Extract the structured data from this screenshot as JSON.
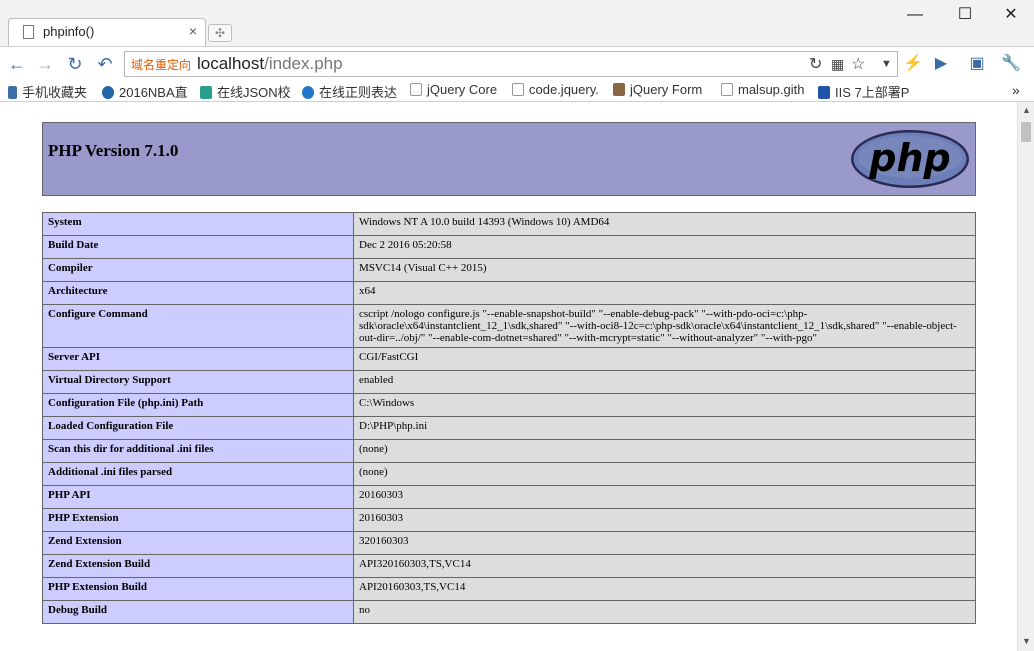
{
  "browser": {
    "tab_title": "phpinfo()",
    "tab_close": "×",
    "window_controls": {
      "minimize": "—",
      "maximize": "☐",
      "close": "✕"
    },
    "address_tag": "域名重定向",
    "url_host": "localhost",
    "url_path": "/index.php"
  },
  "bookmarks": [
    {
      "label": "手机收藏夹",
      "icon": "mobile-icon",
      "color": "#3a6ea5"
    },
    {
      "label": "2016NBA直",
      "icon": "site-icon",
      "color": "#2266aa"
    },
    {
      "label": "在线JSON校",
      "icon": "json-icon",
      "color": "#2a9d8f"
    },
    {
      "label": "在线正则表达",
      "icon": "site-icon",
      "color": "#2277cc"
    },
    {
      "label": "jQuery Core",
      "icon": "page-icon",
      "color": "#999999"
    },
    {
      "label": "code.jquery.",
      "icon": "page-icon",
      "color": "#999999"
    },
    {
      "label": "jQuery Form",
      "icon": "avatar-icon",
      "color": "#886644"
    },
    {
      "label": "malsup.gith",
      "icon": "page-icon",
      "color": "#999999"
    },
    {
      "label": "IIS 7上部署P",
      "icon": "site-icon",
      "color": "#2255aa"
    }
  ],
  "bookmarks_overflow": "»",
  "php": {
    "version_title": "PHP Version 7.1.0",
    "logo_text": "php",
    "rows": [
      {
        "key": "System",
        "value": "Windows NT A 10.0 build 14393 (Windows 10) AMD64"
      },
      {
        "key": "Build Date",
        "value": "Dec 2 2016 05:20:58"
      },
      {
        "key": "Compiler",
        "value": "MSVC14 (Visual C++ 2015)"
      },
      {
        "key": "Architecture",
        "value": "x64"
      },
      {
        "key": "Configure Command",
        "value": "cscript /nologo configure.js \"--enable-snapshot-build\" \"--enable-debug-pack\" \"--with-pdo-oci=c:\\php-sdk\\oracle\\x64\\instantclient_12_1\\sdk,shared\" \"--with-oci8-12c=c:\\php-sdk\\oracle\\x64\\instantclient_12_1\\sdk,shared\" \"--enable-object-out-dir=../obj/\" \"--enable-com-dotnet=shared\" \"--with-mcrypt=static\" \"--without-analyzer\" \"--with-pgo\""
      },
      {
        "key": "Server API",
        "value": "CGI/FastCGI"
      },
      {
        "key": "Virtual Directory Support",
        "value": "enabled"
      },
      {
        "key": "Configuration File (php.ini) Path",
        "value": "C:\\Windows"
      },
      {
        "key": "Loaded Configuration File",
        "value": "D:\\PHP\\php.ini"
      },
      {
        "key": "Scan this dir for additional .ini files",
        "value": "(none)"
      },
      {
        "key": "Additional .ini files parsed",
        "value": "(none)"
      },
      {
        "key": "PHP API",
        "value": "20160303"
      },
      {
        "key": "PHP Extension",
        "value": "20160303"
      },
      {
        "key": "Zend Extension",
        "value": "320160303"
      },
      {
        "key": "Zend Extension Build",
        "value": "API320160303,TS,VC14"
      },
      {
        "key": "PHP Extension Build",
        "value": "API20160303,TS,VC14"
      },
      {
        "key": "Debug Build",
        "value": "no"
      }
    ]
  },
  "colors": {
    "header_bg": "#9999cc",
    "key_bg": "#ccccff",
    "value_bg": "#dddddd",
    "logo_bg": "#6c7eb7"
  }
}
